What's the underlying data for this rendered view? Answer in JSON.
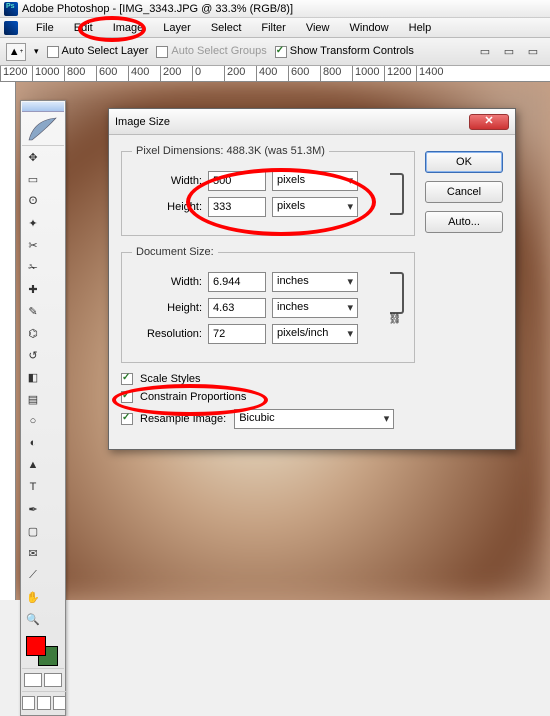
{
  "titlebar": {
    "text": "Adobe Photoshop - [IMG_3343.JPG @ 33.3% (RGB/8)]"
  },
  "menubar": {
    "items": [
      "File",
      "Edit",
      "Image",
      "Layer",
      "Select",
      "Filter",
      "View",
      "Window",
      "Help"
    ]
  },
  "optionsbar": {
    "auto_select_layer": {
      "label": "Auto Select Layer",
      "checked": false
    },
    "auto_select_groups": {
      "label": "Auto Select Groups",
      "checked": false
    },
    "show_transform_controls": {
      "label": "Show Transform Controls",
      "checked": true
    }
  },
  "ruler": {
    "marks": [
      "1200",
      "1000",
      "800",
      "600",
      "400",
      "200",
      "0",
      "200",
      "400",
      "600",
      "800",
      "1000",
      "1200",
      "1400"
    ]
  },
  "toolbox": {
    "swatch_fg": "#ff0000",
    "swatch_bg": "#3d7a3d",
    "tools": [
      "move-tool",
      "rectangular-marquee-tool",
      "lasso-tool",
      "magic-wand-tool",
      "crop-tool",
      "slice-tool",
      "healing-brush-tool",
      "brush-tool",
      "clone-stamp-tool",
      "history-brush-tool",
      "eraser-tool",
      "gradient-tool",
      "blur-tool",
      "dodge-tool",
      "path-selection-tool",
      "type-tool",
      "pen-tool",
      "shape-tool",
      "notes-tool",
      "eyedropper-tool",
      "hand-tool",
      "zoom-tool"
    ]
  },
  "dialog": {
    "title": "Image Size",
    "buttons": {
      "ok": "OK",
      "cancel": "Cancel",
      "auto": "Auto..."
    },
    "pixel_dimensions": {
      "legend": "Pixel Dimensions:  488.3K (was 51.3M)",
      "width_label": "Width:",
      "width_value": "500",
      "width_unit": "pixels",
      "height_label": "Height:",
      "height_value": "333",
      "height_unit": "pixels"
    },
    "document_size": {
      "legend": "Document Size:",
      "width_label": "Width:",
      "width_value": "6.944",
      "width_unit": "inches",
      "height_label": "Height:",
      "height_value": "4.63",
      "height_unit": "inches",
      "resolution_label": "Resolution:",
      "resolution_value": "72",
      "resolution_unit": "pixels/inch"
    },
    "scale_styles": {
      "label": "Scale Styles",
      "checked": true
    },
    "constrain_proportions": {
      "label": "Constrain Proportions",
      "checked": true
    },
    "resample_image": {
      "label": "Resample Image:",
      "checked": true,
      "method": "Bicubic"
    }
  }
}
